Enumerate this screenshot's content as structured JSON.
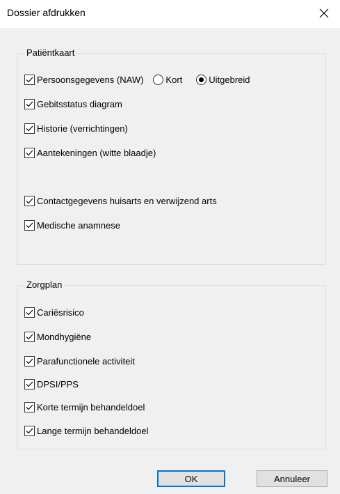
{
  "dialog": {
    "title": "Dossier afdrukken"
  },
  "patientkaart": {
    "legend": "Patiëntkaart",
    "items": [
      {
        "label": "Persoonsgegevens (NAW)",
        "checked": true
      },
      {
        "label": "Gebitsstatus diagram",
        "checked": true
      },
      {
        "label": "Historie (verrichtingen)",
        "checked": true
      },
      {
        "label": "Aantekeningen (witte blaadje)",
        "checked": true
      },
      {
        "label": "Contactgegevens huisarts en verwijzend arts",
        "checked": true
      },
      {
        "label": "Medische anamnese",
        "checked": true
      }
    ],
    "radio_options": [
      {
        "label": "Kort",
        "selected": false
      },
      {
        "label": "Uitgebreid",
        "selected": true
      }
    ]
  },
  "zorgplan": {
    "legend": "Zorgplan",
    "items": [
      {
        "label": "Cariësrisico",
        "checked": true
      },
      {
        "label": "Mondhygiëne",
        "checked": true
      },
      {
        "label": "Parafunctionele activiteit",
        "checked": true
      },
      {
        "label": "DPSI/PPS",
        "checked": true
      },
      {
        "label": "Korte termijn behandeldoel",
        "checked": true
      },
      {
        "label": "Lange termijn behandeldoel",
        "checked": true
      }
    ]
  },
  "buttons": {
    "ok": "OK",
    "cancel": "Annuleer"
  }
}
